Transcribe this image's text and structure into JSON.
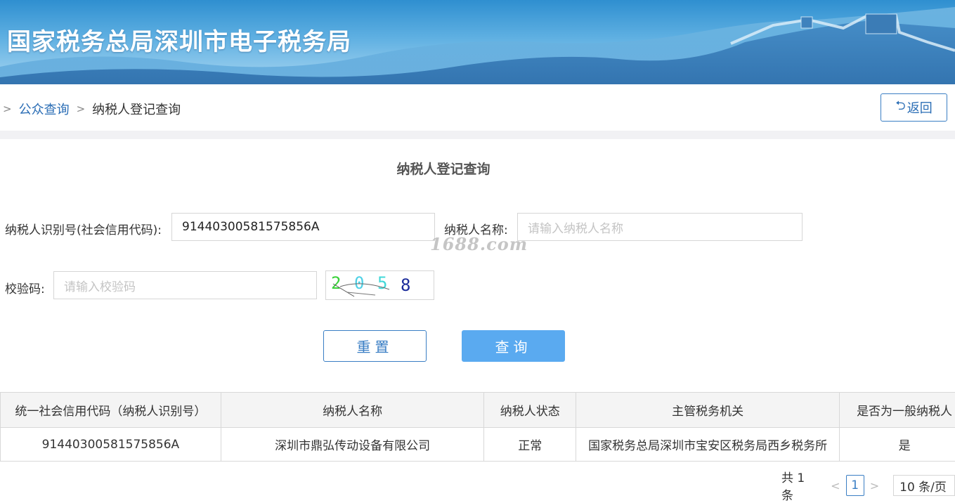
{
  "banner": {
    "title": "国家税务总局深圳市电子税务局"
  },
  "breadcrumb": {
    "sep1": ">",
    "link": "公众查询",
    "sep2": ">",
    "current": "纳税人登记查询"
  },
  "back_button": {
    "icon": "return-arrow-icon",
    "glyph": "⮌",
    "label": "返回"
  },
  "form": {
    "title": "纳税人登记查询",
    "taxpayer_id_label": "纳税人识别号(社会信用代码):",
    "taxpayer_id_value": "91440300581575856A",
    "taxpayer_name_label": "纳税人名称:",
    "taxpayer_name_placeholder": "请输入纳税人名称",
    "captcha_label": "校验码:",
    "captcha_placeholder": "请输入校验码",
    "captcha_chars": [
      "2",
      "0",
      "5",
      "8"
    ],
    "reset_label": "重置",
    "query_label": "查询"
  },
  "watermark": "1688.com",
  "table": {
    "headers": [
      "统一社会信用代码（纳税人识别号）",
      "纳税人名称",
      "纳税人状态",
      "主管税务机关",
      "是否为一般纳税人"
    ],
    "rows": [
      [
        "91440300581575856A",
        "深圳市鼎弘传动设备有限公司",
        "正常",
        "国家税务总局深圳市宝安区税务局西乡税务所",
        "是"
      ]
    ]
  },
  "pagination": {
    "total": "共 1 条",
    "prev": "<",
    "current_page": "1",
    "next": ">",
    "page_size": "10 条/页"
  },
  "colors": {
    "primary": "#3a7ec4",
    "query_button": "#5aaaf0",
    "banner_top": "#2f8fd0"
  }
}
